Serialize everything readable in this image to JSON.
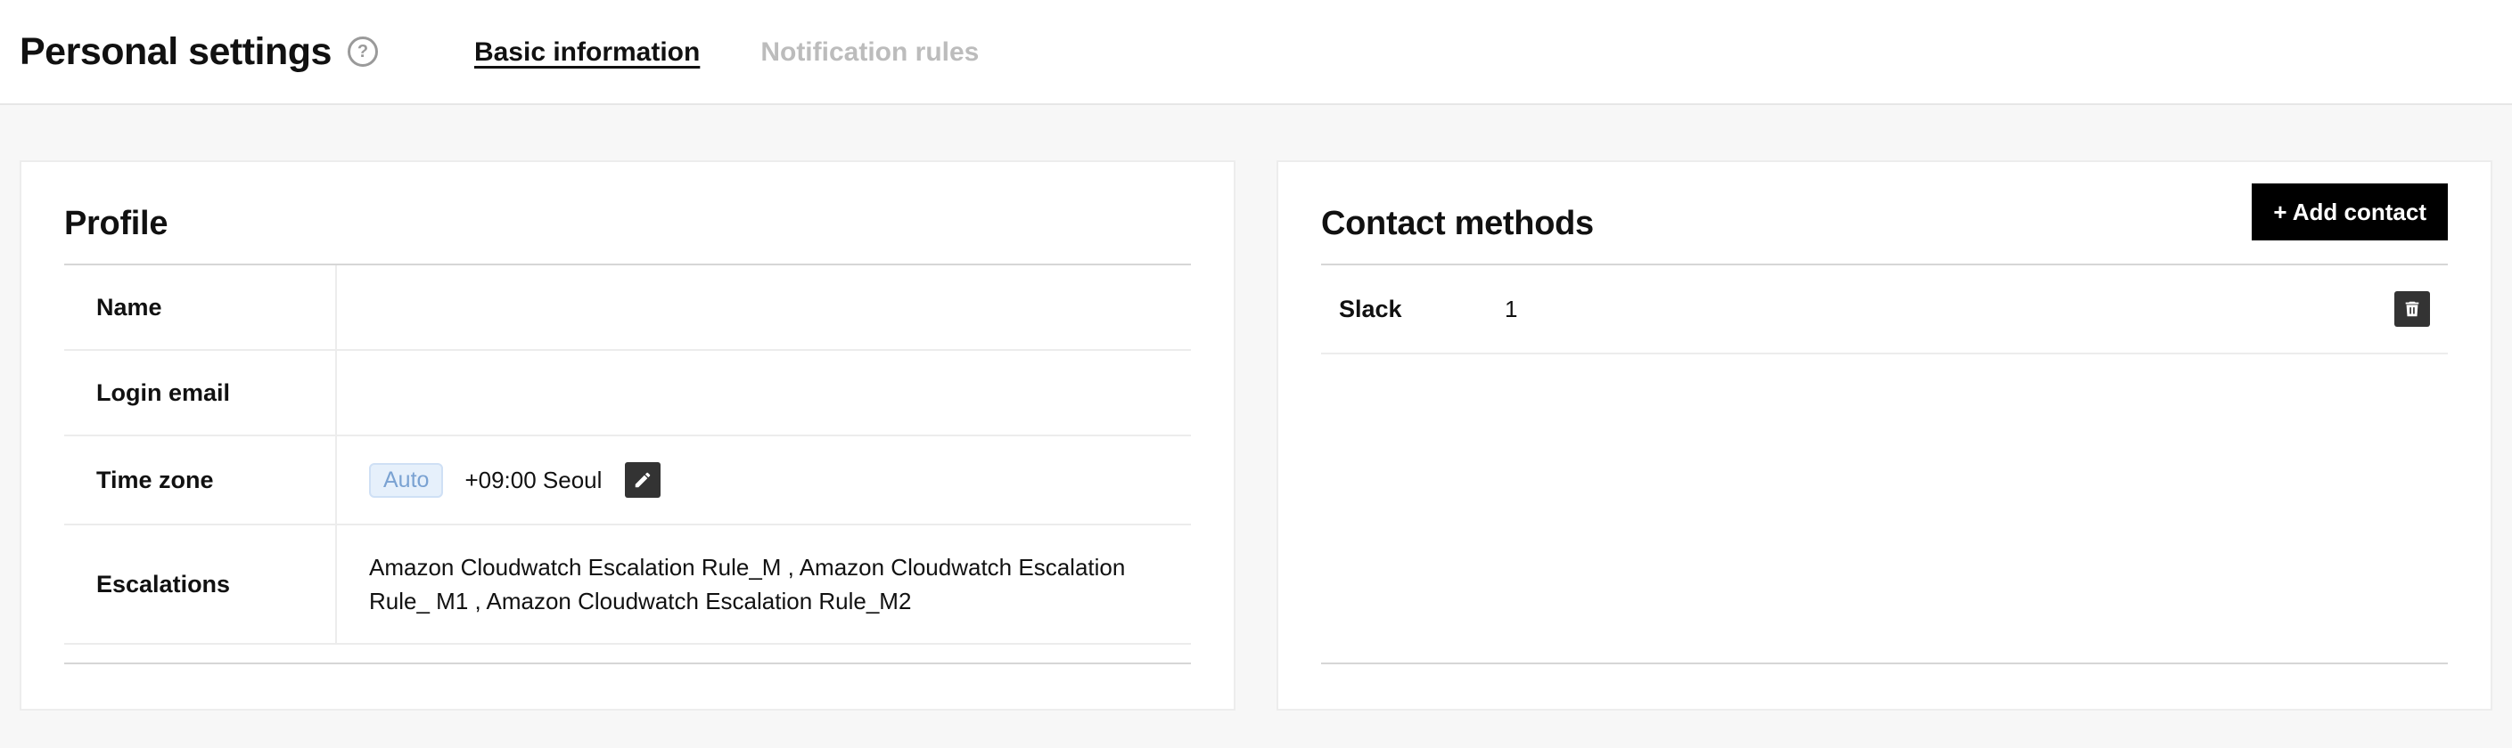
{
  "header": {
    "title": "Personal settings",
    "help_icon": "question-circle-icon",
    "tabs": [
      {
        "label": "Basic information",
        "active": true
      },
      {
        "label": "Notification rules",
        "active": false
      }
    ]
  },
  "profile": {
    "title": "Profile",
    "rows": {
      "name": {
        "label": "Name",
        "value": ""
      },
      "login_email": {
        "label": "Login email",
        "value": ""
      },
      "time_zone": {
        "label": "Time zone",
        "badge": "Auto",
        "value": "+09:00 Seoul",
        "edit_icon": "pencil-icon"
      },
      "escalations": {
        "label": "Escalations",
        "value": "Amazon Cloudwatch Escalation Rule_M , Amazon Cloudwatch Escalation Rule_ M1 , Amazon Cloudwatch Escalation Rule_M2"
      }
    }
  },
  "contact_methods": {
    "title": "Contact methods",
    "add_button_label": "+ Add contact",
    "items": [
      {
        "type": "Slack",
        "value": "1",
        "delete_icon": "trash-icon"
      }
    ]
  },
  "colors": {
    "primary_button": "#000000",
    "badge_bg": "#e6f0fb",
    "badge_text": "#7aa2d2",
    "inactive_tab": "#bcbcbc",
    "page_bg": "#f7f7f7"
  }
}
